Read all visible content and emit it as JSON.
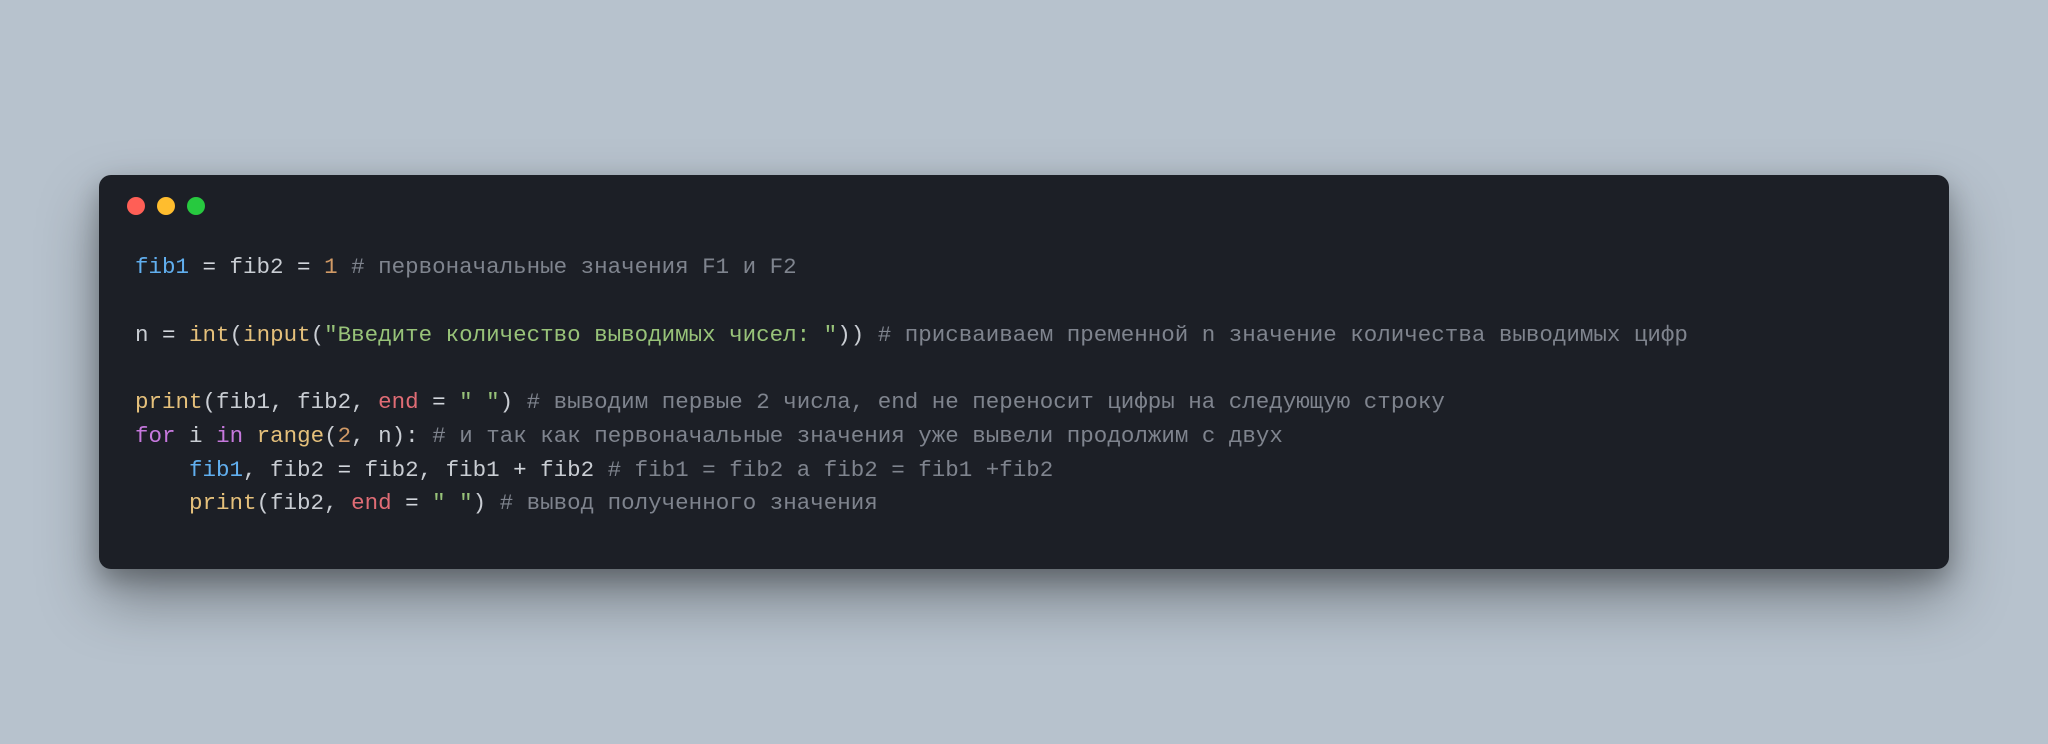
{
  "window": {
    "titlebar": {
      "dotRed": "close",
      "dotYellow": "minimize",
      "dotGreen": "maximize"
    }
  },
  "code": {
    "line1": {
      "var_fib1": "fib1",
      "eq1": " = ",
      "var_fib2": "fib2",
      "eq2": " = ",
      "num_1": "1",
      "sp": " ",
      "comment": "# первоначальные значения F1 и F2"
    },
    "line2": "",
    "line3": {
      "var_n": "n",
      "eq": " = ",
      "func_int": "int",
      "paren_o1": "(",
      "func_input": "input",
      "paren_o2": "(",
      "str": "\"Введите количество выводимых чисел: \"",
      "paren_c": "))",
      "sp": " ",
      "comment": "# присваиваем пременной n значение количества выводимых цифр"
    },
    "line4": "",
    "line5": {
      "func_print": "print",
      "paren_o": "(",
      "var_fib1": "fib1",
      "comma1": ", ",
      "var_fib2": "fib2",
      "comma2": ", ",
      "kwarg_end": "end",
      "eq": " = ",
      "str": "\" \"",
      "paren_c": ")",
      "sp": " ",
      "comment": "# выводим первые 2 числа, end не переносит цифры на следующую строку"
    },
    "line6": {
      "kw_for": "for",
      "sp1": " ",
      "var_i": "i",
      "sp2": " ",
      "kw_in": "in",
      "sp3": " ",
      "func_range": "range",
      "paren_o": "(",
      "num_2": "2",
      "comma": ", ",
      "var_n": "n",
      "paren_c": "):",
      "sp4": " ",
      "comment": "# и так как первоначальные значения уже вывели продолжим с двух"
    },
    "line7": {
      "indent": "    ",
      "var_fib1": "fib1",
      "comma1": ", ",
      "var_fib2": "fib2",
      "eq": " = ",
      "var_fib2b": "fib2",
      "comma2": ", ",
      "var_fib1b": "fib1",
      "plus": " + ",
      "var_fib2c": "fib2",
      "sp": " ",
      "comment": "# fib1 = fib2 а fib2 = fib1 +fib2"
    },
    "line8": {
      "indent": "    ",
      "func_print": "print",
      "paren_o": "(",
      "var_fib2": "fib2",
      "comma": ", ",
      "kwarg_end": "end",
      "eq": " = ",
      "str": "\" \"",
      "paren_c": ")",
      "sp": " ",
      "comment": "# вывод полученного значения"
    }
  }
}
